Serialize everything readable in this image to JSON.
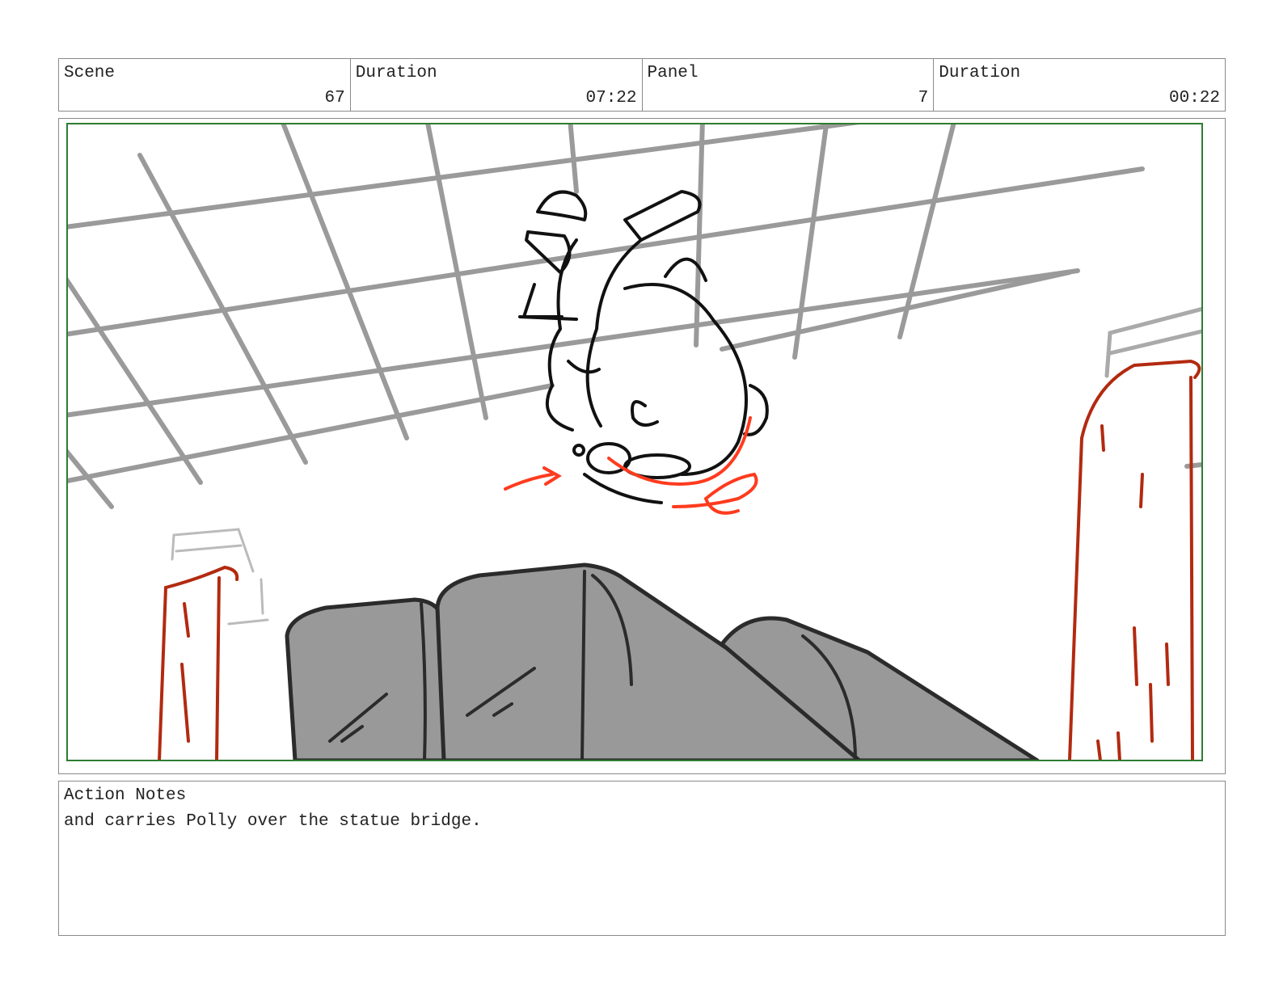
{
  "header": {
    "scene_label": "Scene",
    "scene_value": "67",
    "duration_label": "Duration",
    "duration_value": "07:22",
    "panel_label": "Panel",
    "panel_value": "7",
    "panel_duration_label": "Duration",
    "panel_duration_value": "00:22"
  },
  "notes": {
    "label": "Action Notes",
    "text": "and carries Polly over the statue bridge."
  },
  "colors": {
    "frame_green": "#2e7d32",
    "grid_gray": "#9a9a9a",
    "rock_gray": "#999999",
    "pillar_red": "#b22a10",
    "arrow_red": "#ff3b1f"
  }
}
